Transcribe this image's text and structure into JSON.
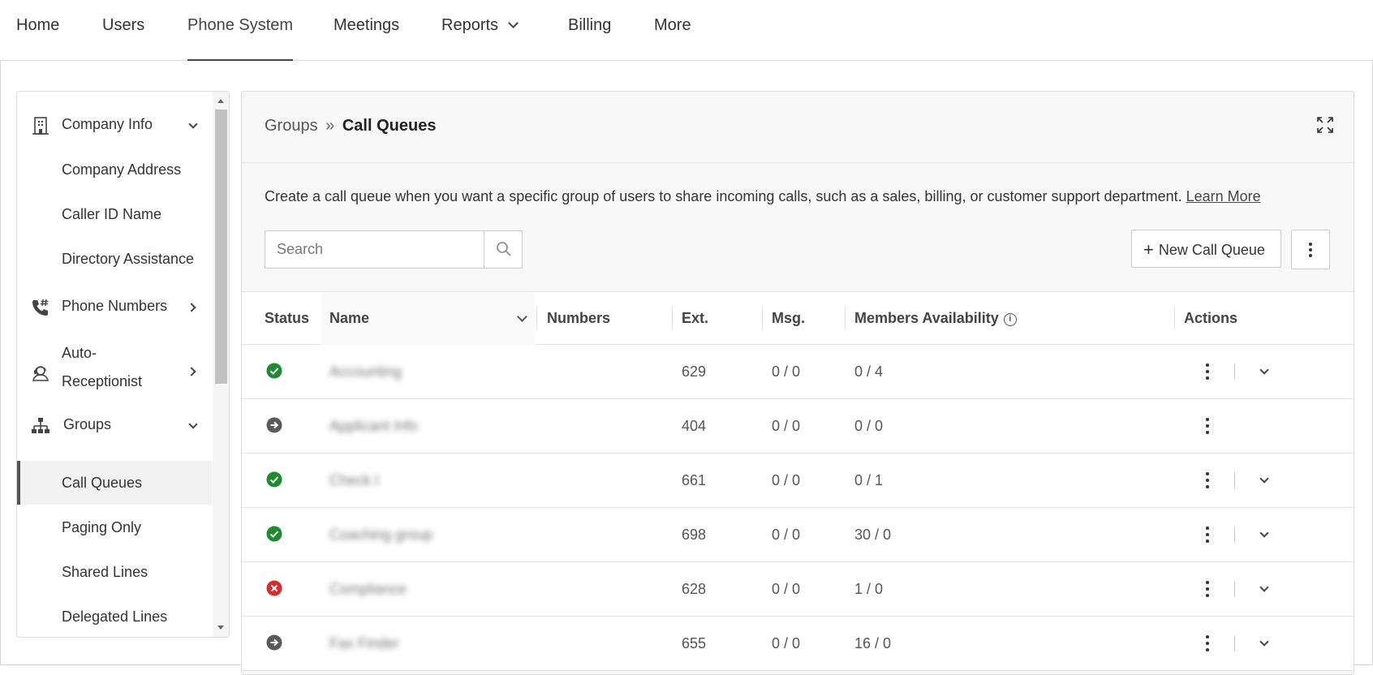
{
  "topnav": {
    "items": [
      {
        "label": "Home"
      },
      {
        "label": "Users"
      },
      {
        "label": "Phone System",
        "active": true
      },
      {
        "label": "Meetings"
      },
      {
        "label": "Reports",
        "dropdown": true
      },
      {
        "label": "Billing"
      },
      {
        "label": "More"
      }
    ]
  },
  "sidebar": {
    "sections": [
      {
        "label": "Company Info",
        "icon": "building-icon",
        "expanded": true,
        "children": [
          "Company Address",
          "Caller ID Name",
          "Directory Assistance"
        ]
      },
      {
        "label": "Phone Numbers",
        "icon": "phone-hash-icon",
        "expanded": false
      },
      {
        "label_line1": "Auto-",
        "label_line2": "Receptionist",
        "icon": "receptionist-icon",
        "expanded": false
      },
      {
        "label": "Groups",
        "icon": "org-chart-icon",
        "expanded": true,
        "children": [
          "Call Queues",
          "Paging Only",
          "Shared Lines",
          "Delegated Lines"
        ],
        "selected": "Call Queues"
      }
    ]
  },
  "breadcrumb": {
    "parent": "Groups",
    "separator": "»",
    "current": "Call Queues"
  },
  "description": {
    "text": "Create a call queue when you want a specific group of users to share incoming calls, such as a sales, billing, or customer support department. ",
    "link": "Learn More"
  },
  "search": {
    "placeholder": "Search",
    "value": ""
  },
  "actions": {
    "new_label": "New Call Queue",
    "new_icon": "plus-icon",
    "more_icon": "kebab-icon"
  },
  "table": {
    "columns": {
      "status": "Status",
      "name": "Name",
      "numbers": "Numbers",
      "ext": "Ext.",
      "msg": "Msg.",
      "members": "Members Availability",
      "actions": "Actions"
    },
    "rows": [
      {
        "status": "active",
        "name": "Accounting",
        "numbers": "",
        "ext": "629",
        "msg": "0 / 0",
        "members": "0 / 4",
        "expand": true
      },
      {
        "status": "forward",
        "name": "Applicant Info",
        "numbers": "",
        "ext": "404",
        "msg": "0 / 0",
        "members": "0 / 0",
        "expand": false
      },
      {
        "status": "active",
        "name": "Check I",
        "numbers": "",
        "ext": "661",
        "msg": "0 / 0",
        "members": "0 / 1",
        "expand": true
      },
      {
        "status": "active",
        "name": "Coaching group",
        "numbers": "",
        "ext": "698",
        "msg": "0 / 0",
        "members": "30 / 0",
        "expand": true
      },
      {
        "status": "inactive",
        "name": "Compliance",
        "numbers": "",
        "ext": "628",
        "msg": "0 / 0",
        "members": "1 / 0",
        "expand": true
      },
      {
        "status": "forward",
        "name": "Fax Finder",
        "numbers": "",
        "ext": "655",
        "msg": "0 / 0",
        "members": "16 / 0",
        "expand": true
      }
    ]
  },
  "colors": {
    "status_active": "#1f8a2f",
    "status_inactive": "#d92b2b",
    "status_forward": "#5a5a5a"
  }
}
